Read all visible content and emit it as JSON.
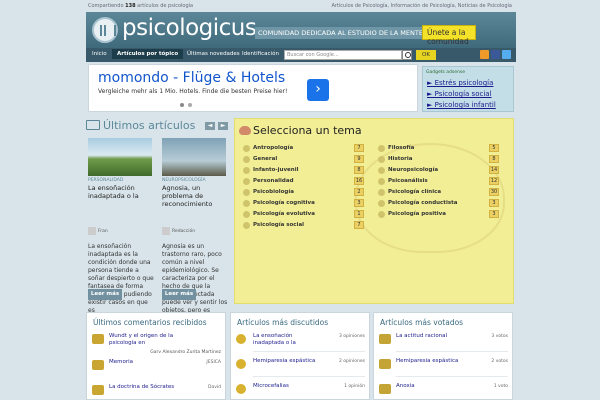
{
  "topline": {
    "count": "138",
    "left_prefix": "Compartiendo",
    "left_suffix": "artículos de psicología",
    "right": "Artículos de Psicología, Información de Psicología, Noticias de Psicología"
  },
  "header": {
    "logo": "psicologicus",
    "tagline": "COMUNIDAD DEDICADA AL ESTUDIO DE LA MENTE",
    "join": "Únete a la comunidad"
  },
  "nav": {
    "items": [
      "Inicio",
      "Artículos por tópico",
      "Últimas novedades",
      "Identificación"
    ],
    "search_placeholder": "Buscar con Google...",
    "ok": "OK"
  },
  "ad": {
    "title": "momondo - Flüge & Hotels",
    "sub": "Vergleiche mehr als 1 Mio. Hotels. Finde die besten Preise hier!",
    "arrow": "›"
  },
  "gadget": {
    "head": "Gadgets adsense",
    "items": [
      "► Estrés psicología",
      "► Psicología social",
      "► Psicología infantil"
    ]
  },
  "latest": {
    "title": "Últimos artículos",
    "prev": "◄",
    "next": "►",
    "cards": [
      {
        "cat": "PERSONALIDAD",
        "title": "La ensoñación inadaptada o la",
        "author": "Fran",
        "body": "La ensoñación inadaptada es la condición donde una persona tiende a soñar despierto o que fantasea de forma exagerada, pudiendo existir casos en que es",
        "more": "Leer más"
      },
      {
        "cat": "NEUROPSICOLOGÍA",
        "title": "Agnosia, un problema de reconocimiento",
        "author": "Redacción",
        "body": "Agnosia es un trastorno raro, poco común a nivel epidemiológico. Se caracteriza por el hecho de que la persona afectada puede ver y sentir los objetos, pero es",
        "more": "Leer más"
      }
    ]
  },
  "topics": {
    "title": "Selecciona un tema",
    "left": [
      {
        "name": "Antropología",
        "count": "7"
      },
      {
        "name": "General",
        "count": "9"
      },
      {
        "name": "Infanto-juvenil",
        "count": "8"
      },
      {
        "name": "Personalidad",
        "count": "16"
      },
      {
        "name": "Psicobiología",
        "count": "2"
      },
      {
        "name": "Psicología cognitiva",
        "count": "3"
      },
      {
        "name": "Psicología evolutiva",
        "count": "1"
      },
      {
        "name": "Psicología social",
        "count": "7"
      }
    ],
    "right": [
      {
        "name": "Filosofía",
        "count": "5"
      },
      {
        "name": "Historia",
        "count": "8"
      },
      {
        "name": "Neuropsicología",
        "count": "14"
      },
      {
        "name": "Psicoanálisis",
        "count": "12"
      },
      {
        "name": "Psicología clínica",
        "count": "30"
      },
      {
        "name": "Psicología conductista",
        "count": "3"
      },
      {
        "name": "Psicología positiva",
        "count": "3"
      }
    ]
  },
  "boxes": [
    {
      "title": "Últimos comentarios recibidos",
      "rows": [
        {
          "t": "Wundt y el origen de la psicología en",
          "m": "",
          "m2": "Garv Alexandro Zurita Martinez"
        },
        {
          "t": "Memoria",
          "m": "JESICA",
          "m2": ""
        },
        {
          "t": "La doctrina de Sócrates",
          "m": "David",
          "m2": ""
        }
      ]
    },
    {
      "title": "Artículos más discutidos",
      "rows": [
        {
          "t": "La ensoñación inadaptada o la",
          "m": "3 opiniones",
          "m2": ""
        },
        {
          "t": "Hemiparesia espástica",
          "m": "2 opiniones",
          "m2": ""
        },
        {
          "t": "Microcefalias",
          "m": "1 opinión",
          "m2": ""
        }
      ]
    },
    {
      "title": "Artículos más votados",
      "rows": [
        {
          "t": "La actitud racional",
          "m": "3 votos",
          "m2": ""
        },
        {
          "t": "Hemiparesia espástica",
          "m": "2 votos",
          "m2": ""
        },
        {
          "t": "Anoxia",
          "m": "1 voto",
          "m2": ""
        }
      ]
    }
  ],
  "colors": {
    "comment_icon": "#c9a632",
    "discuss_icon": "#d8b22e",
    "vote_icon": "#c3a435"
  }
}
